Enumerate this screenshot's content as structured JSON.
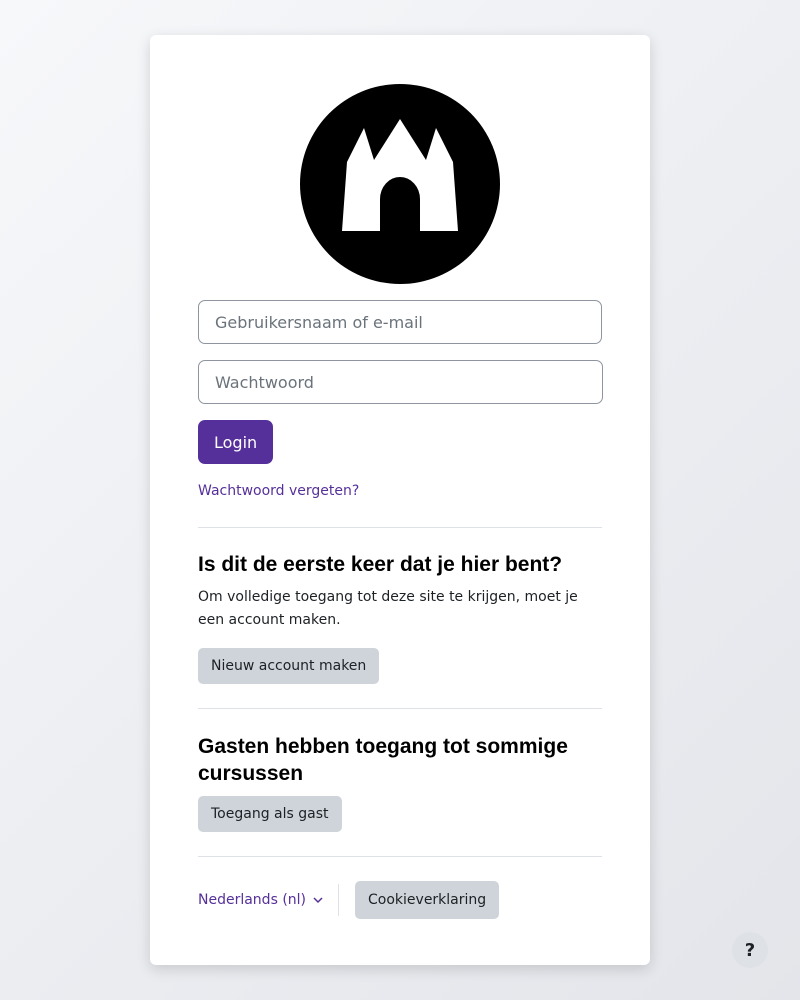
{
  "logo": {
    "icon": "castle-logo-icon",
    "fill": "#000000",
    "accent": "#ffffff"
  },
  "form": {
    "username_placeholder": "Gebruikersnaam of e-mail",
    "password_placeholder": "Wachtwoord",
    "login_label": "Login",
    "forgot_label": "Wachtwoord vergeten?"
  },
  "first_time": {
    "heading": "Is dit de eerste keer dat je hier bent?",
    "description": "Om volledige toegang tot deze site te krijgen, moet je een account maken.",
    "button_label": "Nieuw account maken"
  },
  "guest": {
    "heading": "Gasten hebben toegang tot sommige cursussen",
    "button_label": "Toegang als gast"
  },
  "footer": {
    "language_label": "Nederlands (nl)",
    "cookie_label": "Cookieverklaring"
  },
  "help": {
    "label": "?"
  },
  "colors": {
    "primary": "#56309a",
    "secondary_button": "#ced4da",
    "border": "#8f959e"
  }
}
